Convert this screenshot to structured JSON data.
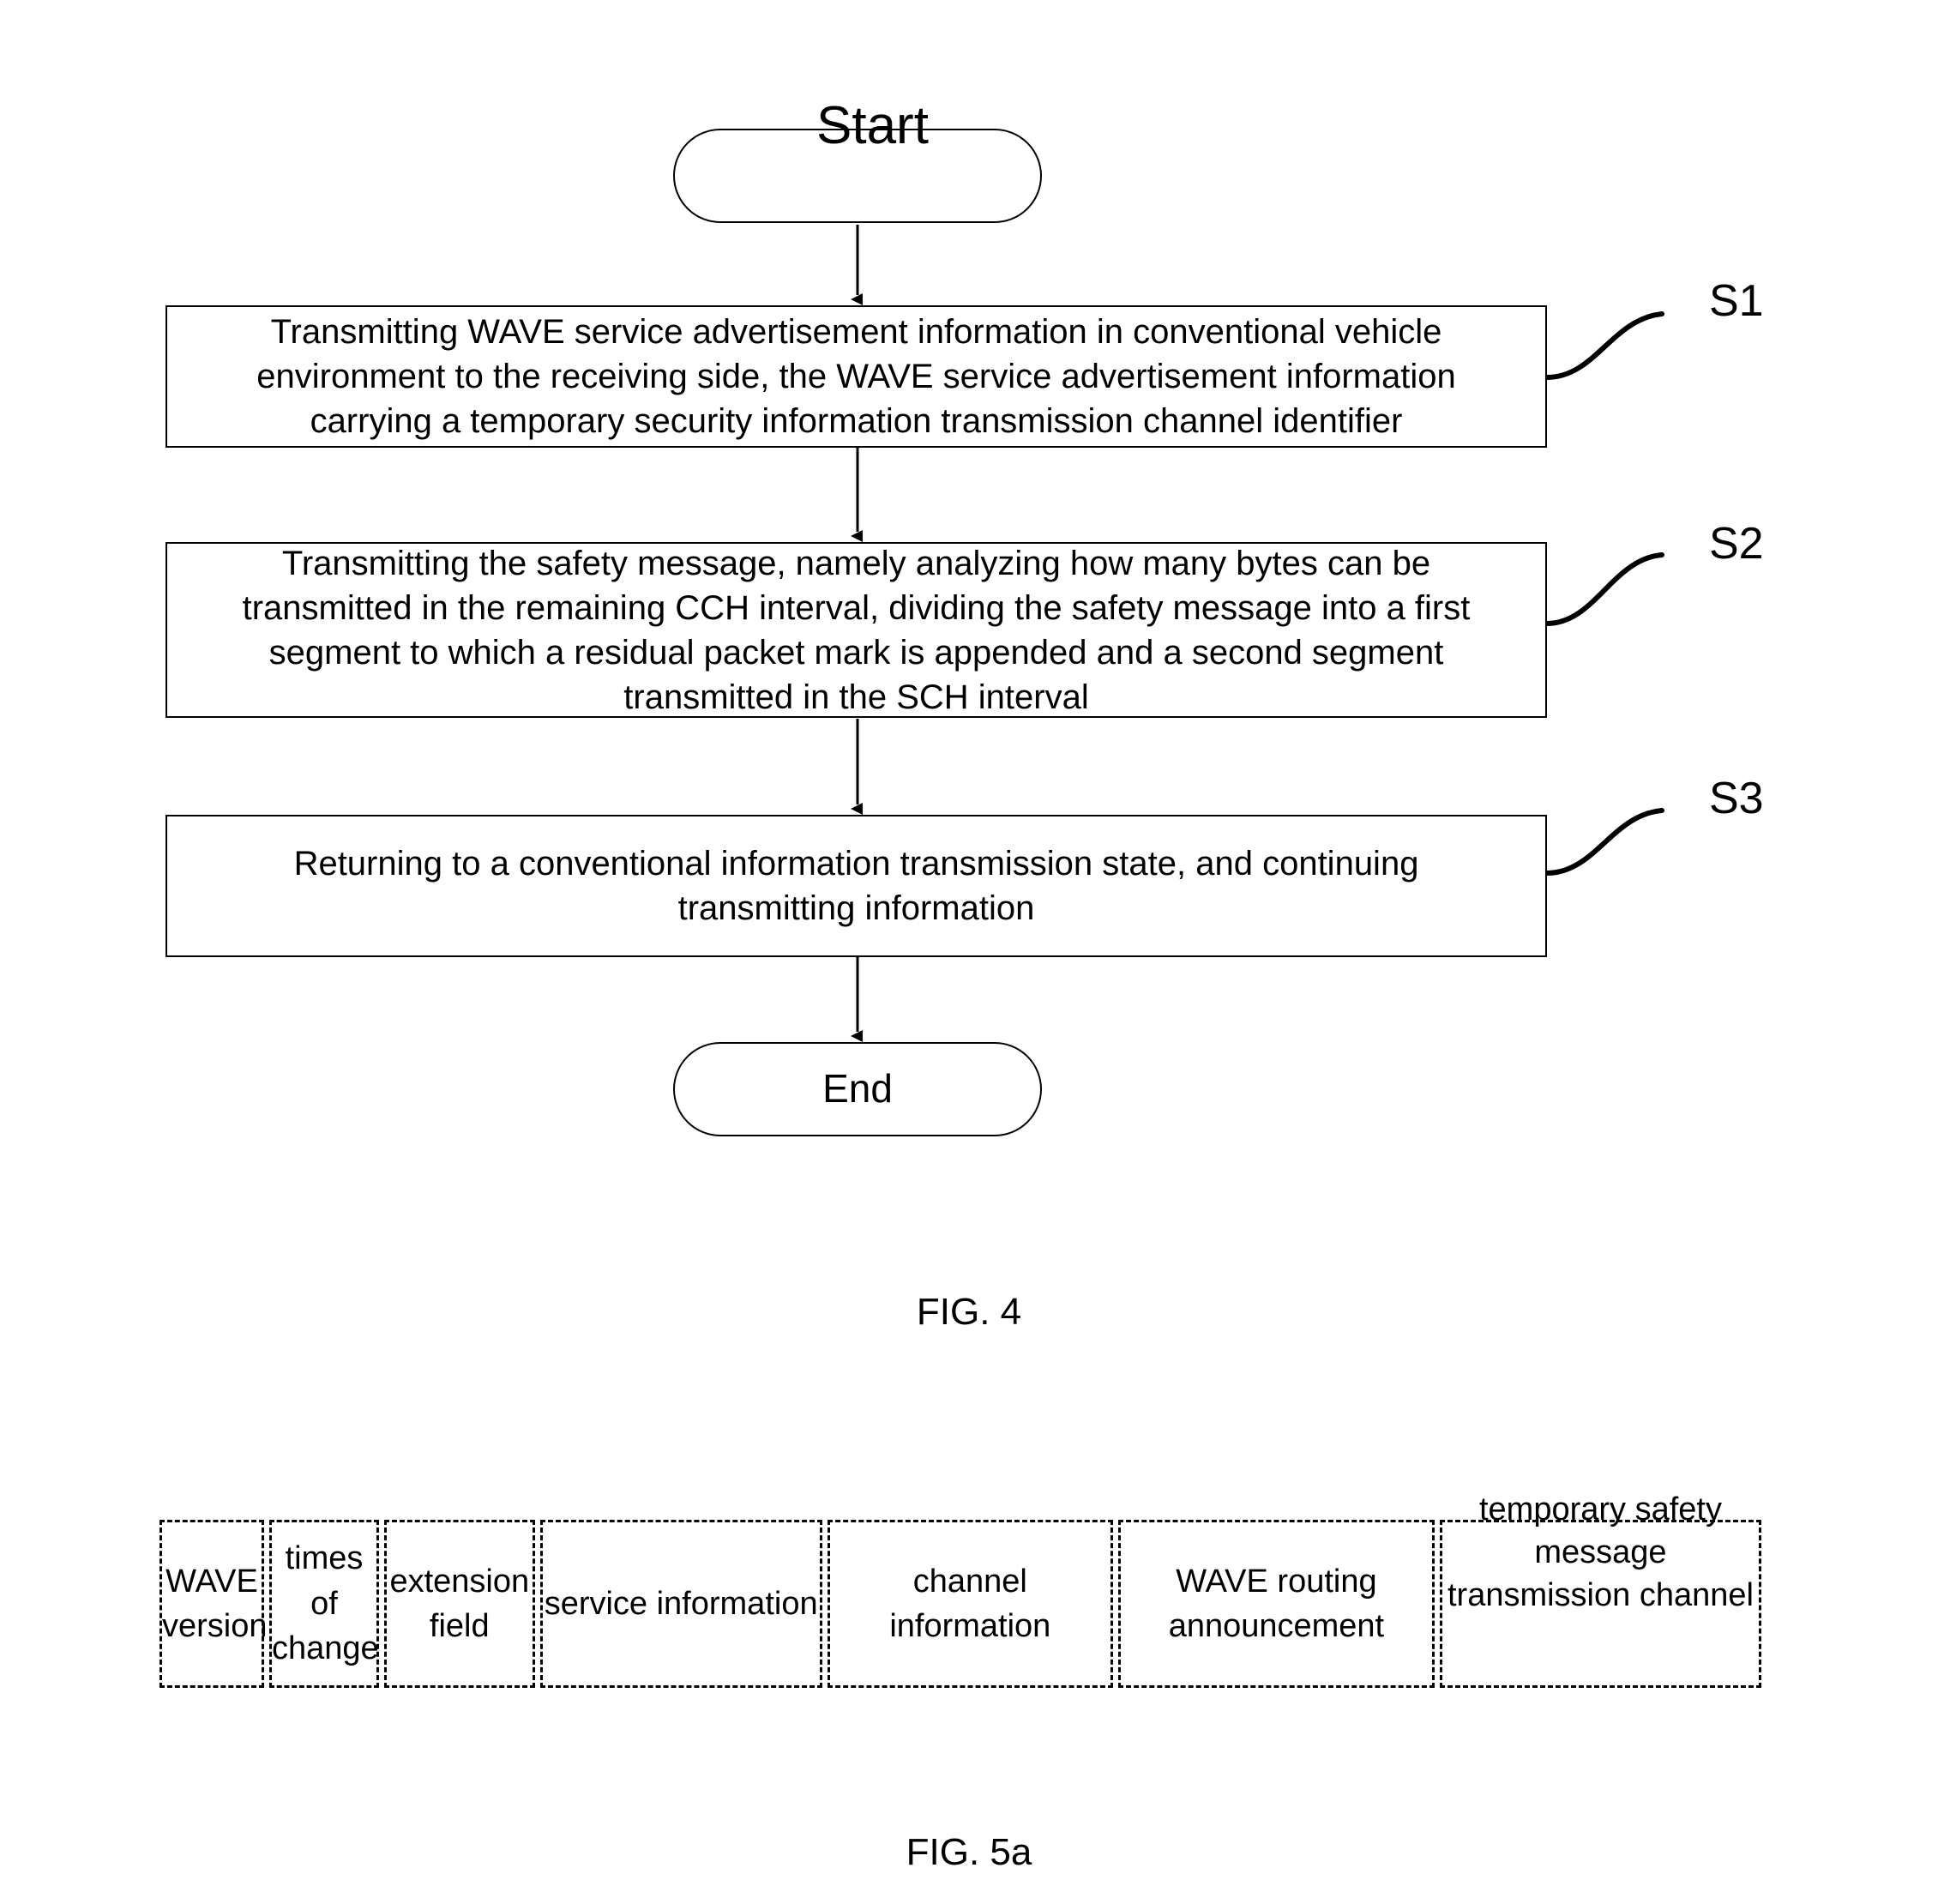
{
  "figure4": {
    "caption": "FIG. 4",
    "start_node": "Start",
    "end_node": "End",
    "steps": [
      {
        "tag": "S1",
        "text": "Transmitting WAVE service advertisement information in conventional vehicle environment to the receiving side, the WAVE service advertisement information carrying a temporary security information transmission channel identifier"
      },
      {
        "tag": "S2",
        "text": "Transmitting the safety message, namely analyzing how many bytes can be transmitted in the remaining CCH interval, dividing the safety message into a first segment to which a residual packet mark is appended and a second segment transmitted in the SCH interval"
      },
      {
        "tag": "S3",
        "text": "Returning to a conventional information transmission state, and continuing transmitting information"
      }
    ]
  },
  "figure5a": {
    "caption": "FIG. 5a",
    "fields": [
      {
        "label": "WAVE version"
      },
      {
        "label": "times of change"
      },
      {
        "label": "extension field"
      },
      {
        "label": "service information"
      },
      {
        "label": "channel information"
      },
      {
        "label": "WAVE routing announcement"
      },
      {
        "label": "temporary safety message transmission channel"
      }
    ]
  },
  "colors": {
    "stroke": "#000000",
    "background": "#ffffff"
  }
}
